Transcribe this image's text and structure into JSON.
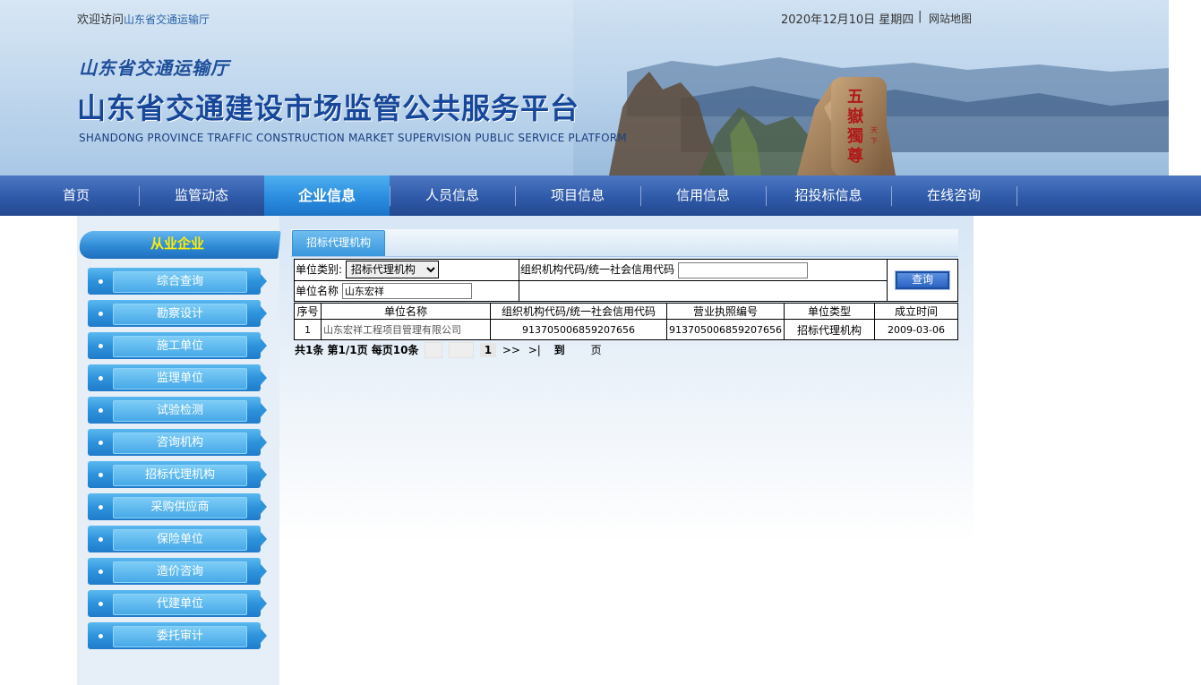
{
  "header": {
    "welcome_prefix": "欢迎访问",
    "welcome_link": "山东省交通运输厅",
    "date": "2020年12月10日 星期四",
    "separator": "|",
    "sitemap": "网站地图",
    "dept_name": "山东省交通运输厅",
    "platform_title": "山东省交通建设市场监管公共服务平台",
    "platform_subtitle": "SHANDONG PROVINCE TRAFFIC CONSTRUCTION MARKET SUPERVISION PUBLIC SERVICE PLATFORM"
  },
  "nav": {
    "items": [
      {
        "label": "首页"
      },
      {
        "label": "监管动态"
      },
      {
        "label": "企业信息",
        "active": true
      },
      {
        "label": "人员信息"
      },
      {
        "label": "项目信息"
      },
      {
        "label": "信用信息"
      },
      {
        "label": "招投标信息"
      },
      {
        "label": "在线咨询"
      }
    ]
  },
  "sidebar": {
    "title": "从业企业",
    "items": [
      {
        "label": "综合查询"
      },
      {
        "label": "勘察设计"
      },
      {
        "label": "施工单位"
      },
      {
        "label": "监理单位"
      },
      {
        "label": "试验检测"
      },
      {
        "label": "咨询机构"
      },
      {
        "label": "招标代理机构"
      },
      {
        "label": "采购供应商"
      },
      {
        "label": "保险单位"
      },
      {
        "label": "造价咨询"
      },
      {
        "label": "代建单位"
      },
      {
        "label": "委托审计"
      }
    ]
  },
  "content": {
    "tab_label": "招标代理机构",
    "search": {
      "unit_type_label": "单位类别:",
      "unit_type_value": "招标代理机构",
      "org_code_label": "组织机构代码/统一社会信用代码",
      "org_code_value": "",
      "unit_name_label": "单位名称",
      "unit_name_value": "山东宏祥",
      "query_button": "查询"
    },
    "table": {
      "headers": [
        "序号",
        "单位名称",
        "组织机构代码/统一社会信用代码",
        "营业执照编号",
        "单位类型",
        "成立时间"
      ],
      "rows": [
        [
          "1",
          "山东宏祥工程项目管理有限公司",
          "913705006859207656",
          "913705006859207656",
          "招标代理机构",
          "2009-03-06"
        ]
      ]
    },
    "pager": {
      "summary": "共1条 第1/1页 每页10条",
      "first": "|<",
      "prev": "<<",
      "current": "1",
      "next": ">>",
      "last": ">|",
      "goto_label": "到",
      "page_unit": "页"
    }
  },
  "colors": {
    "nav_bg": "#2f5aa9",
    "nav_active": "#2d8fe0",
    "side_title": "#ffee00",
    "title_blue": "#17479a"
  }
}
